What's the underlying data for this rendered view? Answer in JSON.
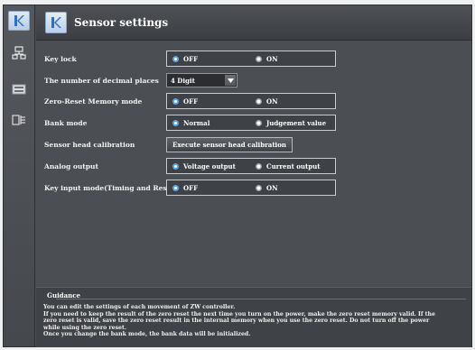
{
  "header": {
    "title": "Sensor settings"
  },
  "toolbar": {
    "items": [
      {
        "icon": "sensor-settings-icon"
      },
      {
        "icon": "network-icon"
      },
      {
        "icon": "display-icon"
      },
      {
        "icon": "layout-icon"
      }
    ]
  },
  "settings": {
    "key_lock": {
      "label": "Key lock",
      "options": [
        "OFF",
        "ON"
      ],
      "selected": "OFF"
    },
    "decimal_places": {
      "label": "The number of decimal places",
      "value": "4 Digit"
    },
    "zero_reset_memory": {
      "label": "Zero-Reset Memory mode",
      "options": [
        "OFF",
        "ON"
      ],
      "selected": "OFF"
    },
    "bank_mode": {
      "label": "Bank mode",
      "options": [
        "Normal",
        "Judgement value"
      ],
      "selected": "Normal"
    },
    "head_calibration": {
      "label": "Sensor head calibration",
      "button": "Execute sensor head calibration"
    },
    "analog_output": {
      "label": "Analog output",
      "options": [
        "Voltage output",
        "Current output"
      ],
      "selected": "Voltage output"
    },
    "key_input_mode": {
      "label": "Key input mode(Timing and Reset)",
      "options": [
        "OFF",
        "ON"
      ],
      "selected": "OFF"
    }
  },
  "guidance": {
    "title": "Guidance",
    "lines": [
      "You can edit the settings of each movement of ZW controller.",
      "If you need to keep the result of the zero reset the next time you turn on the power, make the zero reset memory valid. If the",
      "zero reset is valid, save the zero reset result in the internal memory when you use the zero reset. Do not turn off the power",
      "while using the zero reset.",
      "Once you change the bank mode, the bank data will be initialized."
    ]
  },
  "colors": {
    "accent": "#5fa3ea",
    "panel": "#4b4e53",
    "header": "#3b3e42"
  }
}
